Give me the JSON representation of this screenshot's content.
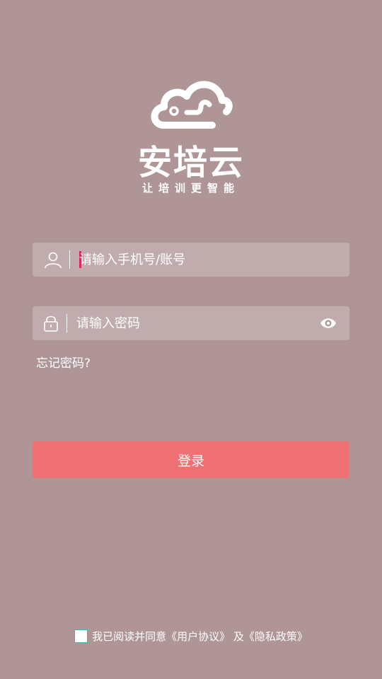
{
  "brand": {
    "name": "安培云",
    "slogan": "让培训更智能"
  },
  "login_form": {
    "account_placeholder": "请输入手机号/账号",
    "account_value": "",
    "password_placeholder": "请输入密码",
    "password_value": "",
    "forgot_label": "忘记密码?",
    "login_label": "登录"
  },
  "agreement": {
    "checked": false,
    "prefix": "我已阅读并同意",
    "user_agreement": "《用户协议》",
    "conjunction": " 及",
    "privacy_policy": "《隐私政策》"
  },
  "colors": {
    "background": "#b09596",
    "button": "#ef7073",
    "caret": "#e0245e",
    "checkbox_border": "#3fb1c7"
  },
  "icons": {
    "logo": "cloud-logo-icon",
    "account": "user-icon",
    "password": "lock-icon",
    "visibility": "eye-icon"
  }
}
